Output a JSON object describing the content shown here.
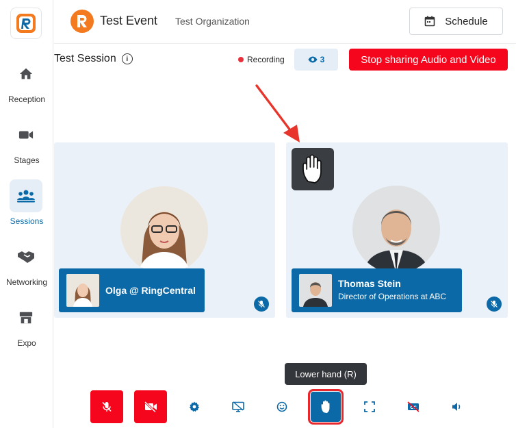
{
  "sidebar": {
    "items": [
      {
        "label": "Reception",
        "icon": "home-icon"
      },
      {
        "label": "Stages",
        "icon": "video-camera-icon"
      },
      {
        "label": "Sessions",
        "icon": "people-group-icon",
        "active": true
      },
      {
        "label": "Networking",
        "icon": "handshake-icon"
      },
      {
        "label": "Expo",
        "icon": "storefront-icon"
      }
    ]
  },
  "header": {
    "event_title": "Test Event",
    "organization": "Test Organization",
    "schedule_label": "Schedule"
  },
  "session": {
    "title": "Test Session",
    "recording_label": "Recording",
    "viewer_count": "3",
    "stop_sharing_label": "Stop sharing Audio and Video"
  },
  "participants": [
    {
      "name": "Olga @ RingCentral",
      "role": ""
    },
    {
      "name": "Thomas Stein",
      "role": "Director of Operations at ABC",
      "hand_raised": true
    }
  ],
  "tooltip": "Lower hand (R)",
  "toolbar": [
    {
      "icon": "mic-off-icon"
    },
    {
      "icon": "camera-off-icon"
    },
    {
      "icon": "gear-icon"
    },
    {
      "icon": "screen-share-icon"
    },
    {
      "icon": "emoji-icon"
    },
    {
      "icon": "raise-hand-icon",
      "active": true
    },
    {
      "icon": "fullscreen-icon"
    },
    {
      "icon": "captions-off-icon"
    },
    {
      "icon": "volume-icon"
    }
  ],
  "colors": {
    "primary": "#0b69a7",
    "danger": "#f5061c",
    "brand_orange": "#f47a20",
    "tile_bg": "#eaf1f8"
  }
}
